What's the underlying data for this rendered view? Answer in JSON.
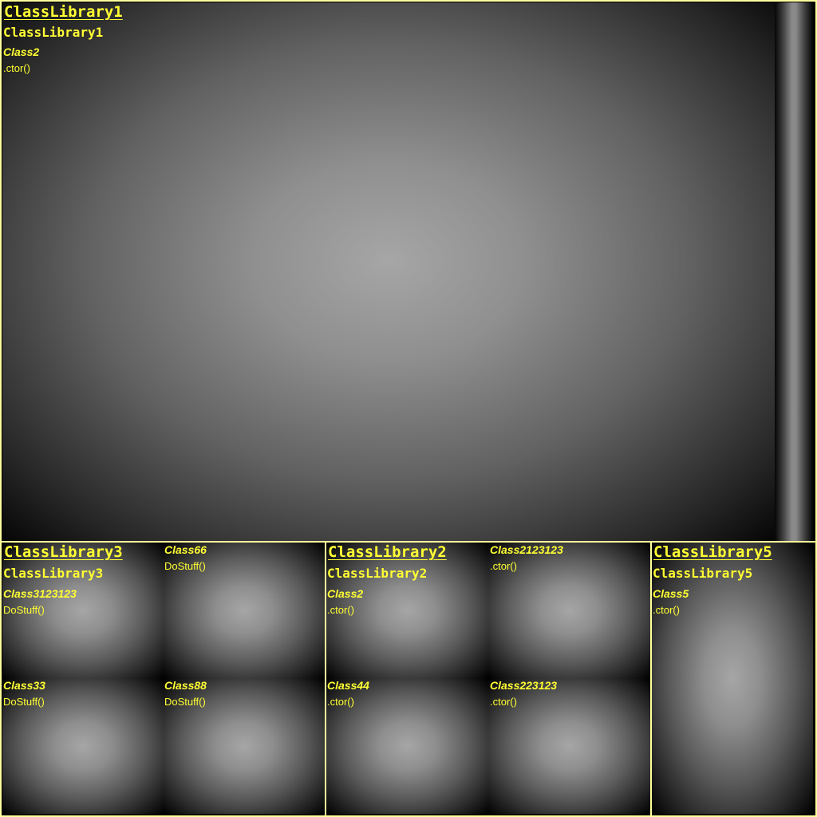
{
  "colors": {
    "border": "#ffff9c",
    "text": "#ffff33",
    "cell_light": "#a6a6a6",
    "cell_dark": "#000000"
  },
  "libraries": [
    {
      "title": "ClassLibrary1",
      "assembly": "ClassLibrary1",
      "classes": [
        {
          "name": "Class2",
          "member": ".ctor()"
        }
      ]
    },
    {
      "title": "ClassLibrary3",
      "assembly": "ClassLibrary3",
      "classes": [
        {
          "name": "Class3123123",
          "member": "DoStuff()"
        },
        {
          "name": "Class66",
          "member": "DoStuff()"
        },
        {
          "name": "Class33",
          "member": "DoStuff()"
        },
        {
          "name": "Class88",
          "member": "DoStuff()"
        }
      ]
    },
    {
      "title": "ClassLibrary2",
      "assembly": "ClassLibrary2",
      "classes": [
        {
          "name": "Class2",
          "member": ".ctor()"
        },
        {
          "name": "Class2123123",
          "member": ".ctor()"
        },
        {
          "name": "Class44",
          "member": ".ctor()"
        },
        {
          "name": "Class223123",
          "member": ".ctor()"
        }
      ]
    },
    {
      "title": "ClassLibrary5",
      "assembly": "ClassLibrary5",
      "classes": [
        {
          "name": "Class5",
          "member": ".ctor()"
        }
      ]
    }
  ]
}
